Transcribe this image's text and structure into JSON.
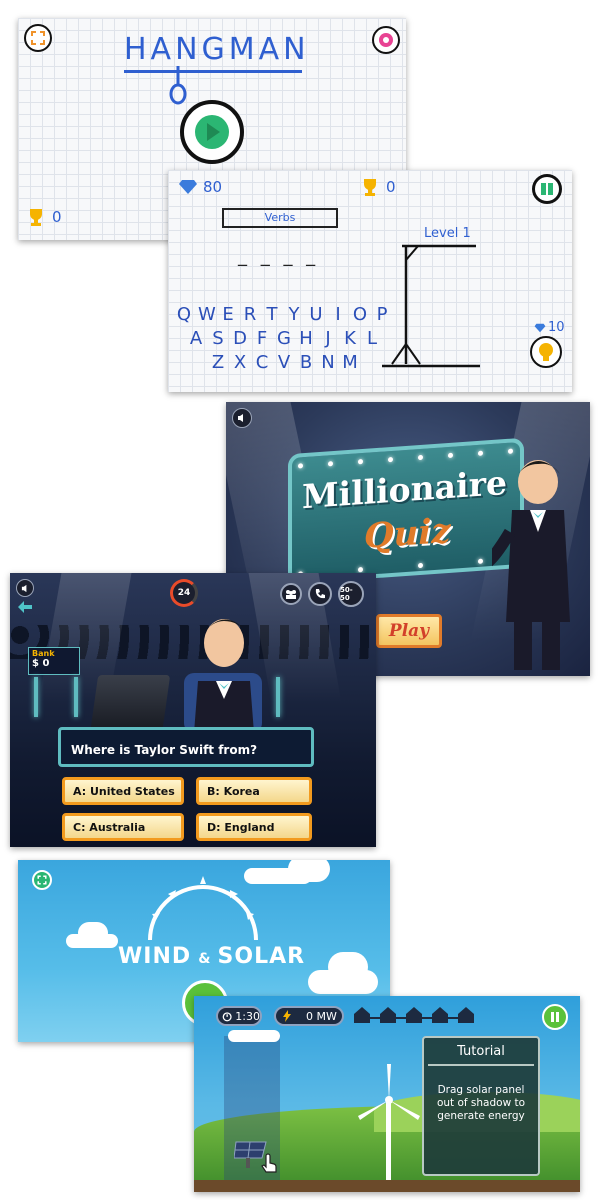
{
  "hangman_menu": {
    "title": "HANGMAN",
    "trophy_count": "0"
  },
  "hangman_game": {
    "diamonds": "80",
    "trophies": "0",
    "category": "Verbs",
    "word_blanks": "_ _ _ _",
    "level": "Level 1",
    "keyboard": {
      "row1": [
        "Q",
        "W",
        "E",
        "R",
        "T",
        "Y",
        "U",
        "I",
        "O",
        "P"
      ],
      "row2": [
        "A",
        "S",
        "D",
        "F",
        "G",
        "H",
        "J",
        "K",
        "L"
      ],
      "row3": [
        "Z",
        "X",
        "C",
        "V",
        "B",
        "N",
        "M"
      ]
    },
    "hint_cost": "10"
  },
  "millionaire_menu": {
    "title_line1": "Millionaire",
    "title_line2": "Quiz",
    "play_label": "Play"
  },
  "millionaire_game": {
    "timer": "24",
    "lifeline_fifty": "50-50",
    "bank_label": "Bank",
    "bank_value": "$ 0",
    "question": "Where is Taylor Swift from?",
    "answers": {
      "a": "A: United States",
      "b": "B: Korea",
      "c": "C: Australia",
      "d": "D: England"
    }
  },
  "wind_solar_menu": {
    "title_wind": "WIND",
    "title_amp": "&",
    "title_solar": "SOLAR"
  },
  "wind_solar_game": {
    "timer": "1:30",
    "power": "0 MW",
    "tutorial_title": "Tutorial",
    "tutorial_text": "Drag solar panel out of shadow to generate energy"
  },
  "colors": {
    "hangman_blue": "#2f5fd0",
    "play_green": "#2bb673",
    "trophy_gold": "#f5b301",
    "quiz_orange": "#f29a1e",
    "quiz_panel_teal": "#5fbcc0",
    "ws_green": "#5ac13b"
  }
}
